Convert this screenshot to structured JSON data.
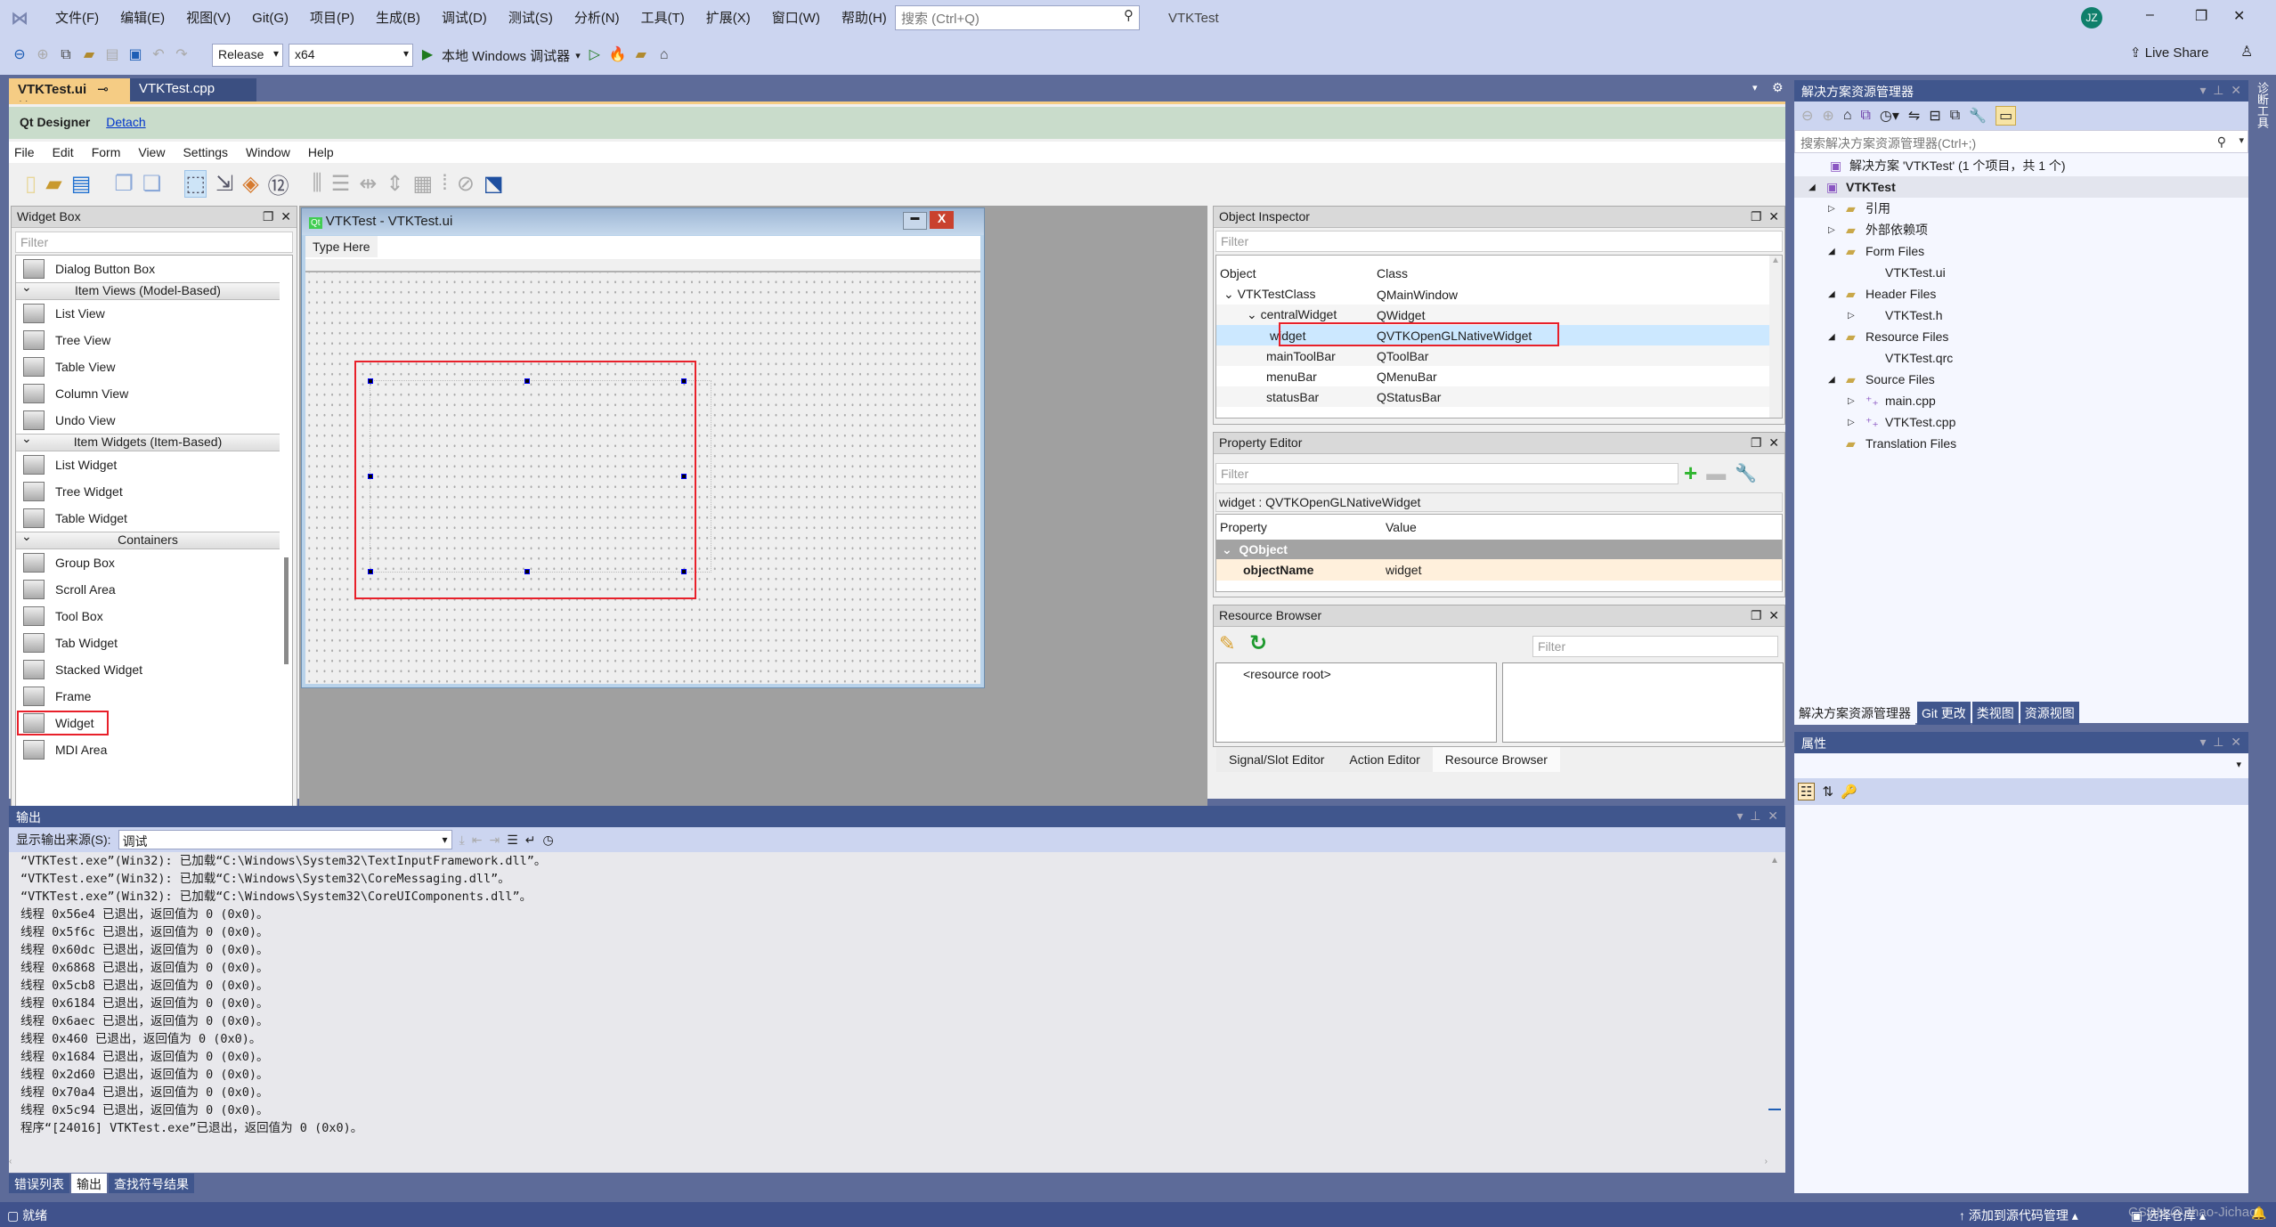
{
  "titlebar": {
    "menu": [
      "文件(F)",
      "编辑(E)",
      "视图(V)",
      "Git(G)",
      "项目(P)",
      "生成(B)",
      "调试(D)",
      "测试(S)",
      "分析(N)",
      "工具(T)",
      "扩展(X)",
      "窗口(W)",
      "帮助(H)"
    ],
    "search_placeholder": "搜索 (Ctrl+Q)",
    "title": "VTKTest",
    "avatar": "JZ",
    "live_share": "Live Share"
  },
  "toolbar": {
    "config": "Release",
    "platform": "x64",
    "run_label": "本地 Windows 调试器"
  },
  "doc_tabs": [
    {
      "label": "VTKTest.ui",
      "active": true
    },
    {
      "label": "VTKTest.cpp",
      "active": false
    }
  ],
  "designer": {
    "title": "Qt Designer",
    "detach": "Detach",
    "menu": [
      "File",
      "Edit",
      "Form",
      "View",
      "Settings",
      "Window",
      "Help"
    ]
  },
  "widget_box": {
    "title": "Widget Box",
    "filter": "Filter",
    "items": [
      {
        "type": "item",
        "label": "Dialog Button Box"
      },
      {
        "type": "cat",
        "label": "Item Views (Model-Based)"
      },
      {
        "type": "item",
        "label": "List View"
      },
      {
        "type": "item",
        "label": "Tree View"
      },
      {
        "type": "item",
        "label": "Table View"
      },
      {
        "type": "item",
        "label": "Column View"
      },
      {
        "type": "item",
        "label": "Undo View"
      },
      {
        "type": "cat",
        "label": "Item Widgets (Item-Based)"
      },
      {
        "type": "item",
        "label": "List Widget"
      },
      {
        "type": "item",
        "label": "Tree Widget"
      },
      {
        "type": "item",
        "label": "Table Widget"
      },
      {
        "type": "cat",
        "label": "Containers"
      },
      {
        "type": "item",
        "label": "Group Box"
      },
      {
        "type": "item",
        "label": "Scroll Area"
      },
      {
        "type": "item",
        "label": "Tool Box"
      },
      {
        "type": "item",
        "label": "Tab Widget"
      },
      {
        "type": "item",
        "label": "Stacked Widget"
      },
      {
        "type": "item",
        "label": "Frame"
      },
      {
        "type": "item",
        "label": "Widget",
        "highlighted": true
      },
      {
        "type": "item",
        "label": "MDI Area"
      }
    ]
  },
  "form": {
    "title": "VTKTest - VTKTest.ui",
    "menu_placeholder": "Type Here"
  },
  "object_inspector": {
    "title": "Object Inspector",
    "filter": "Filter",
    "col_object": "Object",
    "col_class": "Class",
    "rows": [
      {
        "object": "VTKTestClass",
        "class": "QMainWindow",
        "indent": 0
      },
      {
        "object": "centralWidget",
        "class": "QWidget",
        "indent": 1
      },
      {
        "object": "widget",
        "class": "QVTKOpenGLNativeWidget",
        "indent": 2,
        "selected": true
      },
      {
        "object": "mainToolBar",
        "class": "QToolBar",
        "indent": 1
      },
      {
        "object": "menuBar",
        "class": "QMenuBar",
        "indent": 1
      },
      {
        "object": "statusBar",
        "class": "QStatusBar",
        "indent": 1
      }
    ]
  },
  "property_editor": {
    "title": "Property Editor",
    "filter": "Filter",
    "context": "widget : QVTKOpenGLNativeWidget",
    "col_property": "Property",
    "col_value": "Value",
    "group": "QObject",
    "prop_name": "objectName",
    "prop_value": "widget"
  },
  "resource_browser": {
    "title": "Resource Browser",
    "filter": "Filter",
    "root": "<resource root>",
    "tabs": [
      "Signal/Slot Editor",
      "Action Editor",
      "Resource Browser"
    ]
  },
  "solution_explorer": {
    "title": "解决方案资源管理器",
    "search_placeholder": "搜索解决方案资源管理器(Ctrl+;)",
    "tree": [
      {
        "label": "解决方案 'VTKTest' (1 个项目，共 1 个)",
        "level": 0,
        "arrow": ""
      },
      {
        "label": "VTKTest",
        "level": 0,
        "arrow": "◢",
        "bold": true
      },
      {
        "label": "引用",
        "level": 1,
        "arrow": "▷"
      },
      {
        "label": "外部依赖项",
        "level": 1,
        "arrow": "▷"
      },
      {
        "label": "Form Files",
        "level": 1,
        "arrow": "◢"
      },
      {
        "label": "VTKTest.ui",
        "level": 2,
        "arrow": ""
      },
      {
        "label": "Header Files",
        "level": 1,
        "arrow": "◢"
      },
      {
        "label": "VTKTest.h",
        "level": 2,
        "arrow": "▷"
      },
      {
        "label": "Resource Files",
        "level": 1,
        "arrow": "◢"
      },
      {
        "label": "VTKTest.qrc",
        "level": 2,
        "arrow": ""
      },
      {
        "label": "Source Files",
        "level": 1,
        "arrow": "◢"
      },
      {
        "label": "main.cpp",
        "level": 2,
        "arrow": "▷"
      },
      {
        "label": "VTKTest.cpp",
        "level": 2,
        "arrow": "▷"
      },
      {
        "label": "Translation Files",
        "level": 1,
        "arrow": ""
      }
    ],
    "tabs": [
      "解决方案资源管理器",
      "Git 更改",
      "类视图",
      "资源视图"
    ]
  },
  "properties": {
    "title": "属性"
  },
  "side_strip": "诊断工具",
  "output": {
    "title": "输出",
    "source_label": "显示输出来源(S):",
    "source_value": "调试",
    "lines": [
      "“VTKTest.exe”(Win32): 已加载“C:\\Windows\\System32\\TextInputFramework.dll”。",
      "“VTKTest.exe”(Win32): 已加载“C:\\Windows\\System32\\CoreMessaging.dll”。",
      "“VTKTest.exe”(Win32): 已加载“C:\\Windows\\System32\\CoreUIComponents.dll”。",
      "线程 0x56e4 已退出，返回值为 0 (0x0)。",
      "线程 0x5f6c 已退出，返回值为 0 (0x0)。",
      "线程 0x60dc 已退出，返回值为 0 (0x0)。",
      "线程 0x6868 已退出，返回值为 0 (0x0)。",
      "线程 0x5cb8 已退出，返回值为 0 (0x0)。",
      "线程 0x6184 已退出，返回值为 0 (0x0)。",
      "线程 0x6aec 已退出，返回值为 0 (0x0)。",
      "线程 0x460 已退出，返回值为 0 (0x0)。",
      "线程 0x1684 已退出，返回值为 0 (0x0)。",
      "线程 0x2d60 已退出，返回值为 0 (0x0)。",
      "线程 0x70a4 已退出，返回值为 0 (0x0)。",
      "线程 0x5c94 已退出，返回值为 0 (0x0)。",
      "程序“[24016] VTKTest.exe”已退出，返回值为 0 (0x0)。"
    ],
    "bottom_tabs": [
      "错误列表",
      "输出",
      "查找符号结果"
    ]
  },
  "statusbar": {
    "ready": "就绪",
    "add_source": "添加到源代码管理",
    "select_repo": "选择仓库",
    "watermark": "CSDN @Zhao-Jichao"
  },
  "colors": {
    "vs_bg": "#5d6b99",
    "title_bg": "#ccd5f0",
    "panel_head": "#40568d",
    "status_bg": "#40528c",
    "highlight_red": "#e8202a",
    "selection": "#cce8ff",
    "active_tab": "#f5cc84"
  }
}
